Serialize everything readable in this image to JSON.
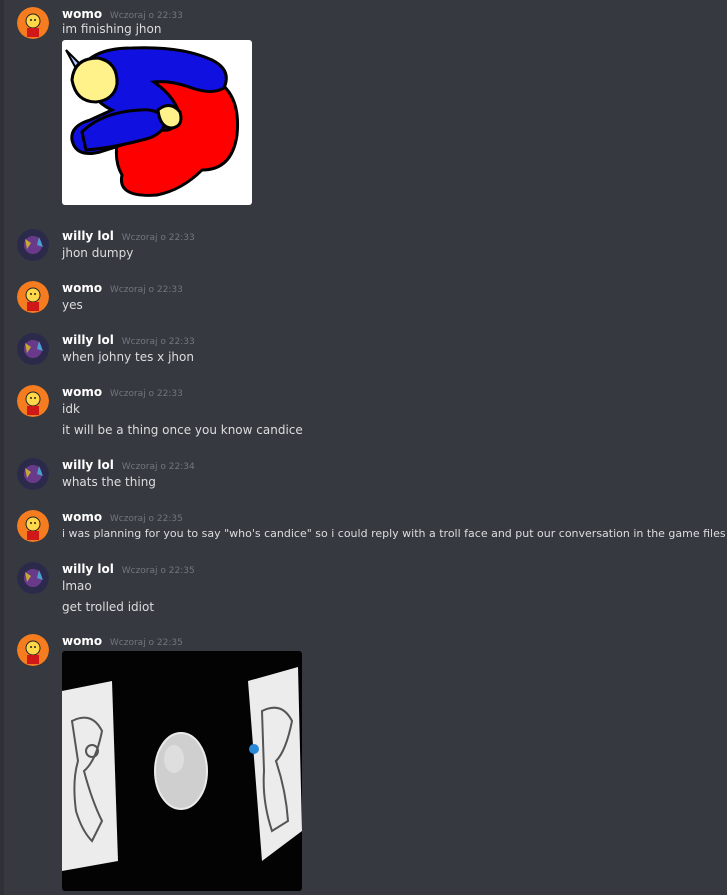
{
  "chat": {
    "messages": [
      {
        "author": "womo",
        "timestamp": "Wczoraj o 22:33",
        "lines": [
          "im finishing jhon"
        ],
        "attachment": "drawing of jhon hugging himself"
      },
      {
        "author": "willy lol",
        "timestamp": "Wczoraj o 22:33",
        "lines": [
          "jhon dumpy"
        ]
      },
      {
        "author": "womo",
        "timestamp": "Wczoraj o 22:33",
        "lines": [
          "yes"
        ]
      },
      {
        "author": "willy lol",
        "timestamp": "Wczoraj o 22:33",
        "lines": [
          "when johny tes x jhon"
        ]
      },
      {
        "author": "womo",
        "timestamp": "Wczoraj o 22:33",
        "lines": [
          "idk",
          "it will be a thing once you know candice"
        ]
      },
      {
        "author": "willy lol",
        "timestamp": "Wczoraj o 22:34",
        "lines": [
          "whats the thing"
        ]
      },
      {
        "author": "womo",
        "timestamp": "Wczoraj o 22:35",
        "lines": [
          "i was planning for you to say \"who's candice\" so i could reply with a troll face and put our conversation in the game files"
        ]
      },
      {
        "author": "willy lol",
        "timestamp": "Wczoraj o 22:35",
        "lines": [
          "lmao",
          "get trolled idiot"
        ]
      },
      {
        "author": "womo",
        "timestamp": "Wczoraj o 22:35",
        "lines": [],
        "attachment": "grayscale image with egg shape"
      }
    ]
  },
  "colors": {
    "background": "#36393f",
    "username": "#ffffff",
    "timestamp": "#72767d",
    "text": "#dcddde",
    "womo_avatar_bg": "#f57c1f",
    "willy_avatar_bg": "#2b2a4a"
  }
}
